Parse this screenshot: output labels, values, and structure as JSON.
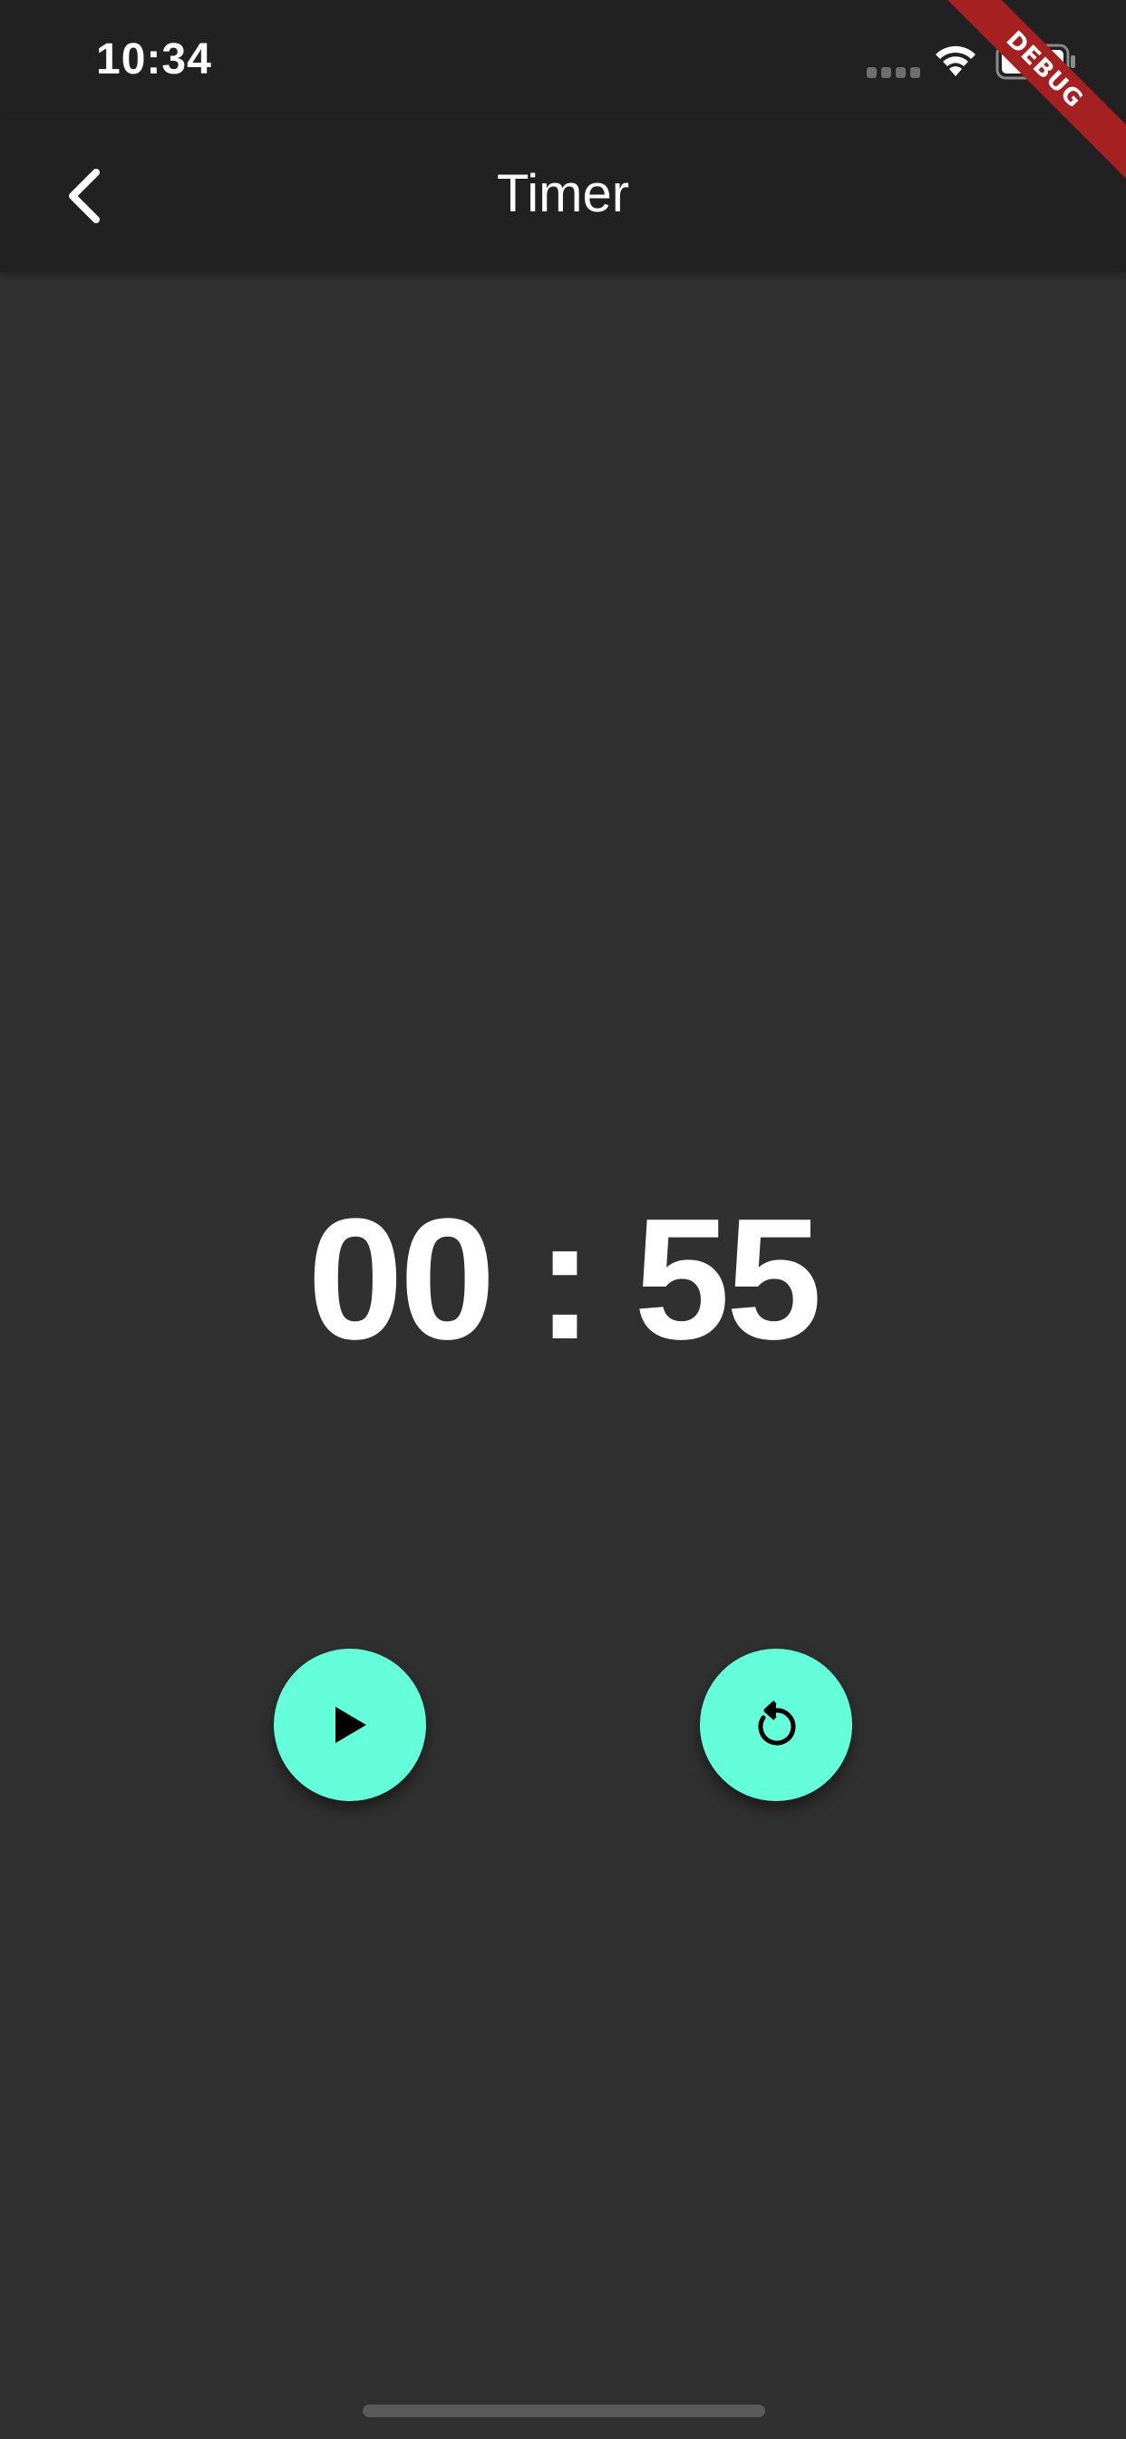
{
  "status_bar": {
    "time": "10:34",
    "signal_icon": "cellular-signal-icon",
    "wifi_icon": "wifi-icon",
    "battery_icon": "battery-icon"
  },
  "app_bar": {
    "title": "Timer",
    "back_icon": "chevron-left-icon"
  },
  "timer": {
    "minutes": "00",
    "separator": ":",
    "seconds": "55"
  },
  "controls": {
    "play_icon": "play-icon",
    "reset_icon": "restart-icon",
    "button_color": "#64FFDA",
    "icon_color": "#000000"
  },
  "debug_banner": {
    "label": "DEBUG",
    "color": "#A52020"
  },
  "colors": {
    "background": "#303030",
    "app_bar": "#212121",
    "text": "#FFFFFF"
  }
}
